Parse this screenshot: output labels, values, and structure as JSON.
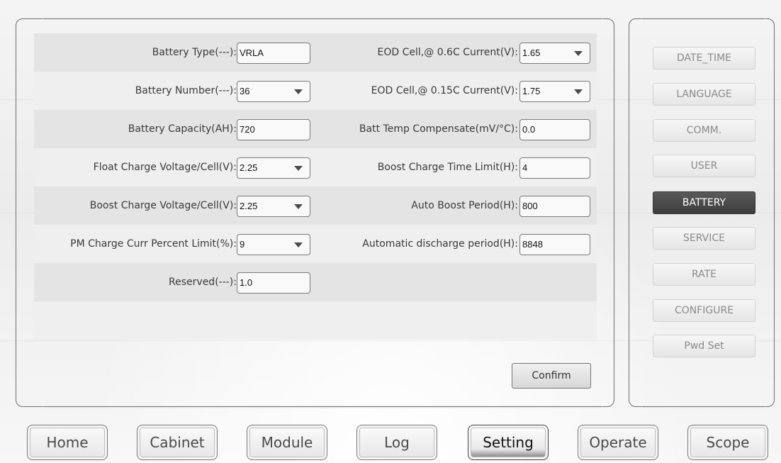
{
  "form": {
    "rows": [
      {
        "left": {
          "label": "Battery Type(---):",
          "value": "VRLA"
        },
        "right": {
          "label": "EOD Cell,@ 0.6C Current(V):",
          "value": "1.65"
        }
      },
      {
        "left": {
          "label": "Battery Number(---):",
          "value": "36"
        },
        "right": {
          "label": "EOD Cell,@ 0.15C Current(V):",
          "value": "1.75"
        }
      },
      {
        "left": {
          "label": "Battery Capacity(AH):",
          "value": "720"
        },
        "right": {
          "label": "Batt Temp Compensate(mV/°C):",
          "value": "0.0"
        }
      },
      {
        "left": {
          "label": "Float Charge Voltage/Cell(V):",
          "value": "2.25"
        },
        "right": {
          "label": "Boost Charge Time Limit(H):",
          "value": "4"
        }
      },
      {
        "left": {
          "label": "Boost Charge Voltage/Cell(V):",
          "value": "2.25"
        },
        "right": {
          "label": "Auto Boost Period(H):",
          "value": "800"
        }
      },
      {
        "left": {
          "label": "PM Charge Curr Percent Limit(%):",
          "value": "9"
        },
        "right": {
          "label": "Automatic discharge period(H):",
          "value": "8848"
        }
      },
      {
        "left": {
          "label": "Reserved(---):",
          "value": "1.0"
        }
      }
    ],
    "confirm_label": "Confirm"
  },
  "side_menu": {
    "items": [
      "DATE_TIME",
      "LANGUAGE",
      "COMM.",
      "USER",
      "BATTERY",
      "SERVICE",
      "RATE",
      "CONFIGURE",
      "Pwd Set"
    ],
    "active": "BATTERY"
  },
  "bottom_nav": {
    "items": [
      "Home",
      "Cabinet",
      "Module",
      "Log",
      "Setting",
      "Operate",
      "Scope"
    ],
    "active": "Setting"
  },
  "icons": {
    "dropdown": "chevron-down-icon"
  },
  "colors": {
    "active_side": "#3d3d3d",
    "active_side_text": "#ffffff"
  }
}
